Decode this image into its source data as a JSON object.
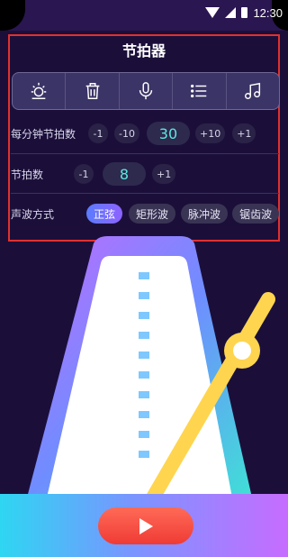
{
  "status_bar": {
    "time": "12:30"
  },
  "page": {
    "title": "节拍器"
  },
  "toolbar": {
    "tools": [
      {
        "icon": "sun-icon"
      },
      {
        "icon": "trash-icon"
      },
      {
        "icon": "microphone-icon"
      },
      {
        "icon": "list-icon"
      },
      {
        "icon": "music-note-icon"
      }
    ]
  },
  "bpm": {
    "label": "每分钟节拍数",
    "dec1": "-1",
    "dec10": "-10",
    "value": "30",
    "inc10": "+10",
    "inc1": "+1"
  },
  "beats": {
    "label": "节拍数",
    "dec1": "-1",
    "value": "8",
    "inc1": "+1"
  },
  "wave": {
    "label": "声波方式",
    "options": [
      "正弦",
      "矩形波",
      "脉冲波",
      "锯齿波"
    ],
    "selected": "正弦"
  },
  "colors": {
    "accent_value": "#5fe6e0",
    "play_button": "#ef3b34",
    "pendulum": "#ffd54f",
    "highlight_box": "#e0312f"
  }
}
